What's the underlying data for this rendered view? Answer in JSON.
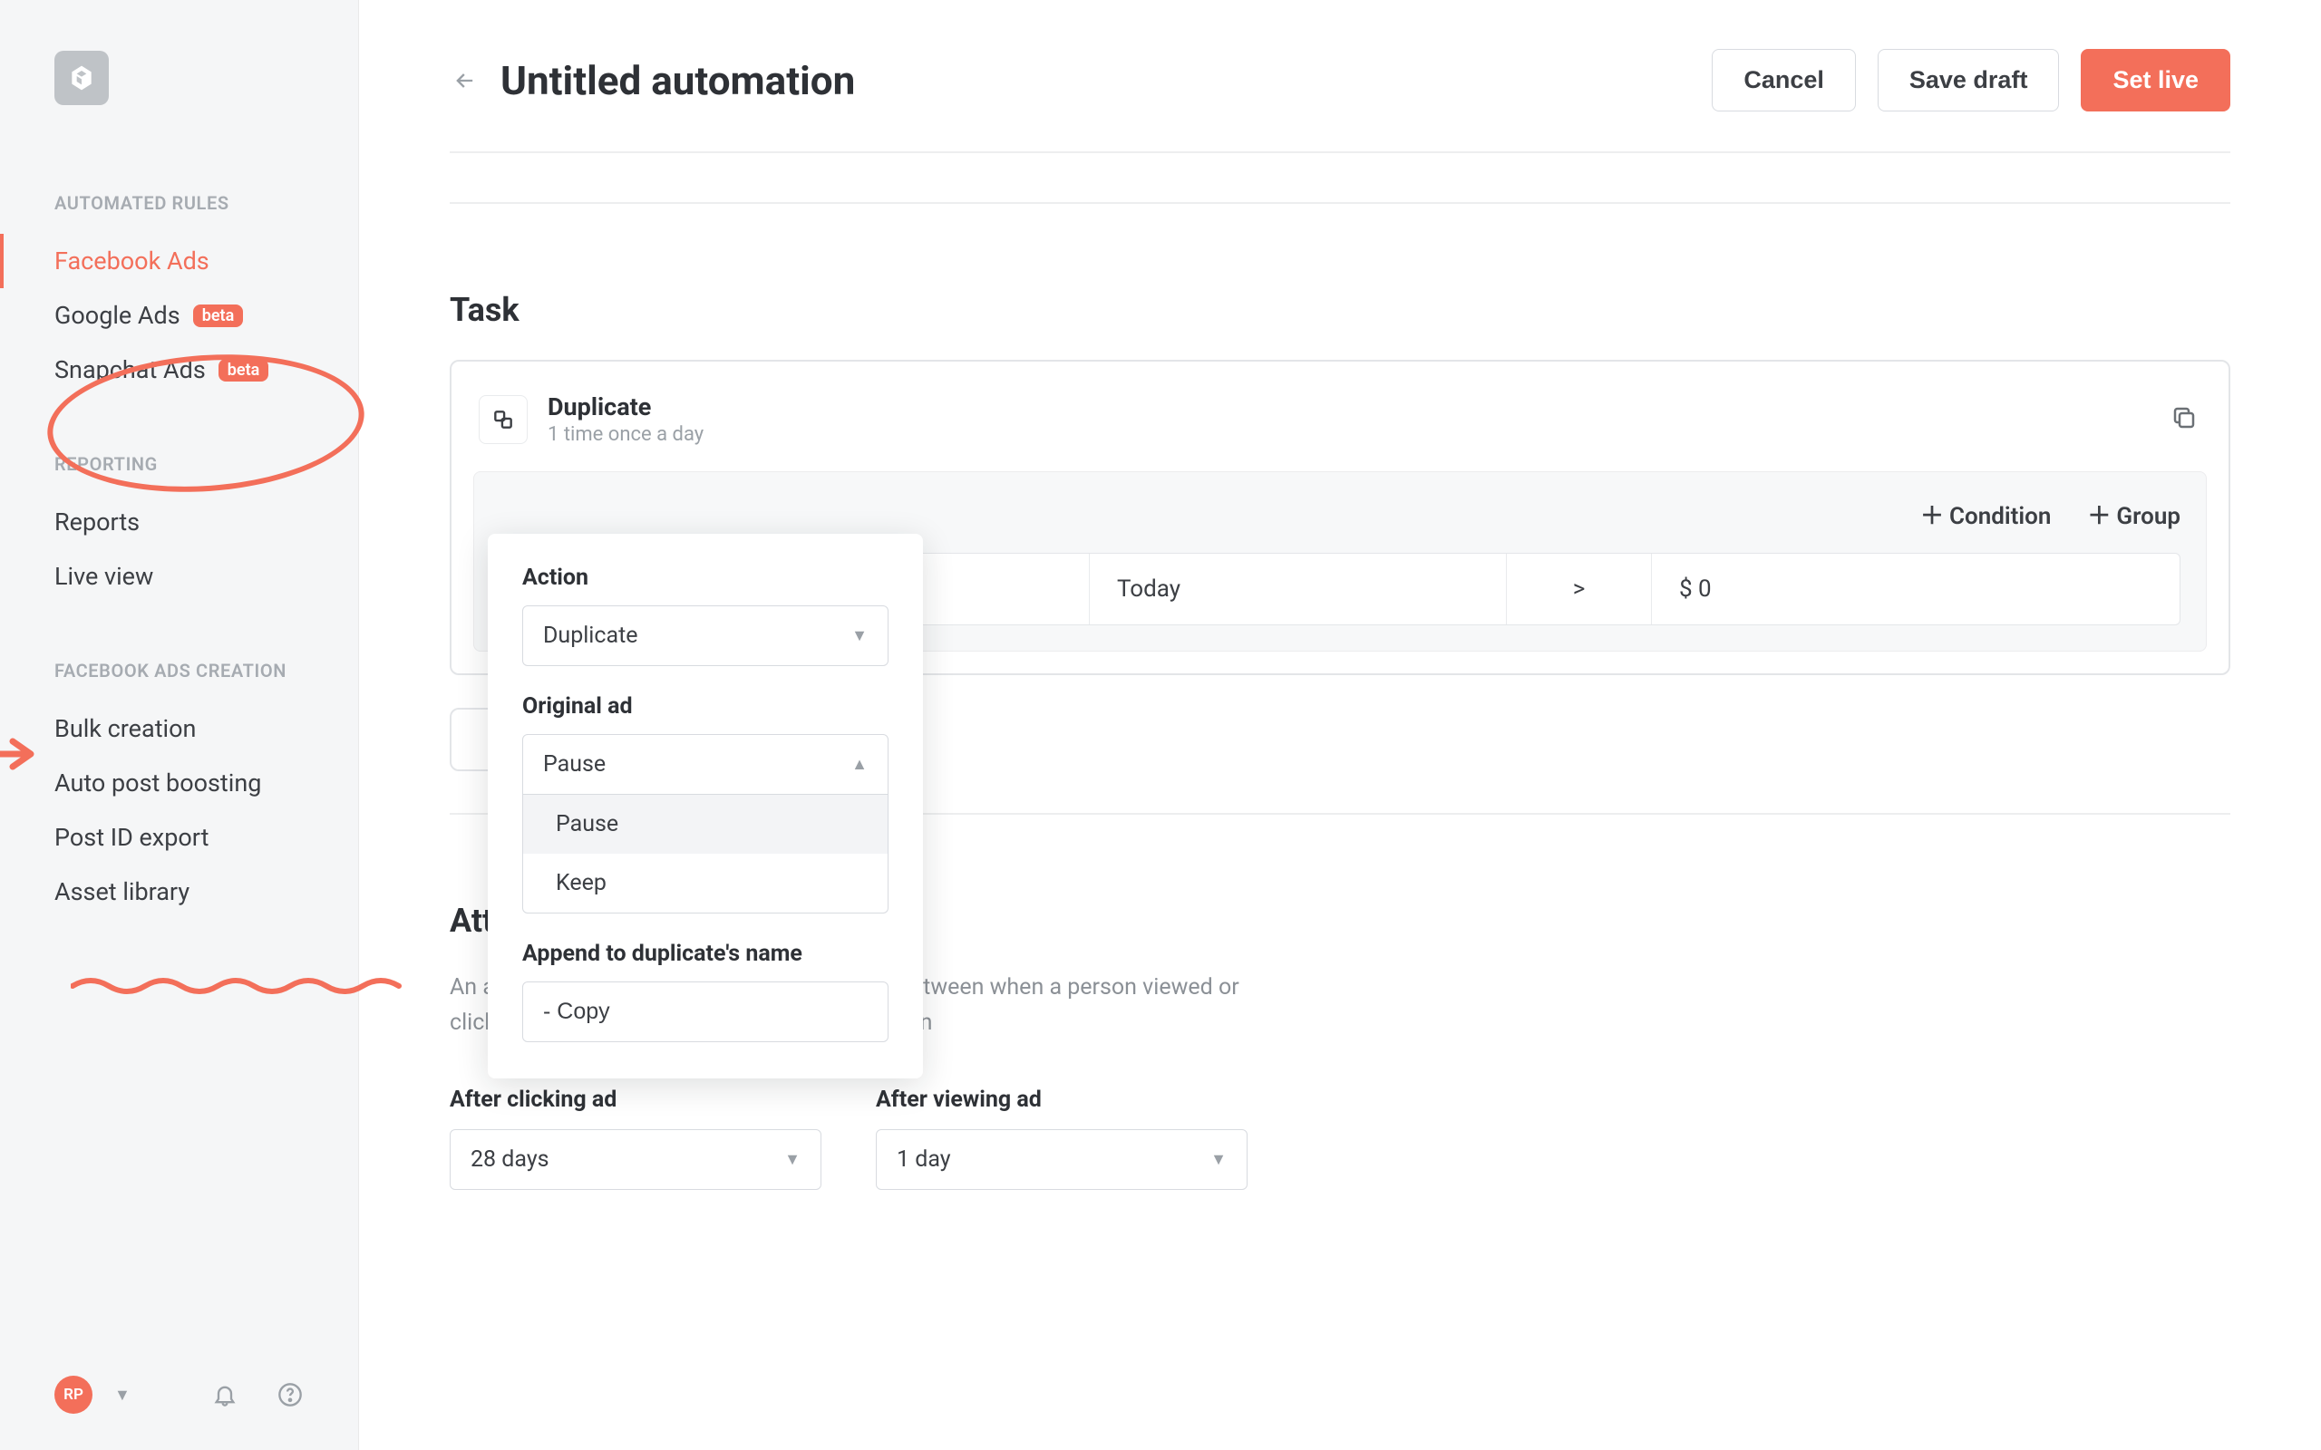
{
  "sidebar": {
    "sections": [
      {
        "heading": "AUTOMATED RULES",
        "items": [
          {
            "label": "Facebook Ads",
            "active": true
          },
          {
            "label": "Google Ads",
            "badge": "beta"
          },
          {
            "label": "Snapchat Ads",
            "badge": "beta"
          }
        ]
      },
      {
        "heading": "REPORTING",
        "items": [
          {
            "label": "Reports"
          },
          {
            "label": "Live view"
          }
        ]
      },
      {
        "heading": "FACEBOOK ADS CREATION",
        "items": [
          {
            "label": "Bulk creation"
          },
          {
            "label": "Auto post boosting"
          },
          {
            "label": "Post ID export"
          },
          {
            "label": "Asset library"
          }
        ]
      }
    ],
    "avatar": "RP"
  },
  "header": {
    "title": "Untitled automation",
    "cancel": "Cancel",
    "save_draft": "Save draft",
    "set_live": "Set live"
  },
  "task": {
    "section_title": "Task",
    "name": "Duplicate",
    "frequency": "1 time once a day",
    "cond_button_condition": "Condition",
    "cond_button_group": "Group",
    "row": {
      "when": "Today",
      "op": ">",
      "value": "$ 0"
    }
  },
  "popover": {
    "action_label": "Action",
    "action_value": "Duplicate",
    "original_ad_label": "Original ad",
    "original_ad_value": "Pause",
    "options": {
      "pause": "Pause",
      "keep": "Keep"
    },
    "append_label": "Append to duplicate's name",
    "append_value": "- Copy"
  },
  "attribution": {
    "title": "Attribution window",
    "desc": "An attribution window is the number of days between when a person viewed or clicked your ad and subsequently took an action",
    "click_label": "After clicking ad",
    "click_value": "28 days",
    "view_label": "After viewing ad",
    "view_value": "1 day"
  }
}
